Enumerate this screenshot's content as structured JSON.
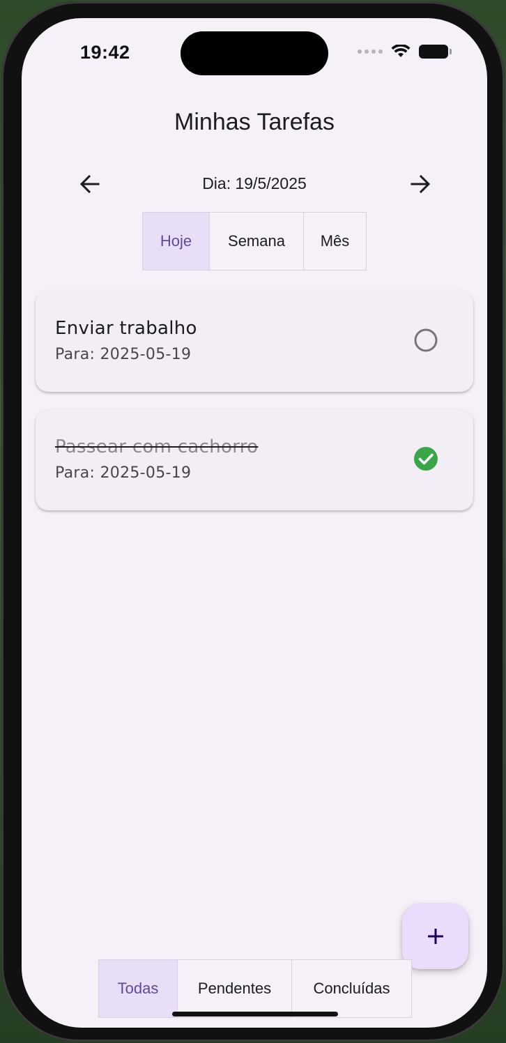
{
  "status_bar": {
    "time": "19:42",
    "icons": [
      "signal-icon",
      "wifi-icon",
      "battery-icon"
    ]
  },
  "header": {
    "title": "Minhas Tarefas"
  },
  "date_nav": {
    "label": "Dia: 19/5/2025",
    "prev_icon": "arrow-left-icon",
    "next_icon": "arrow-right-icon"
  },
  "range_selector": {
    "options": [
      "Hoje",
      "Semana",
      "Mês"
    ],
    "selected": "Hoje"
  },
  "tasks": [
    {
      "title": "Enviar trabalho",
      "date": "Para: 2025-05-19",
      "completed": false
    },
    {
      "title": "Passear com cachorro",
      "date": "Para: 2025-05-19",
      "completed": true
    }
  ],
  "fab": {
    "icon": "plus-icon"
  },
  "filter_selector": {
    "options": [
      "Todas",
      "Pendentes",
      "Concluídas"
    ],
    "selected": "Todas"
  },
  "colors": {
    "background": "#f6f1f8",
    "selected_segment": "#e8def8",
    "selected_text": "#5f4a9a",
    "card": "#f3edf5",
    "fab": "#eaddfb",
    "check_green": "#3aa64a"
  }
}
